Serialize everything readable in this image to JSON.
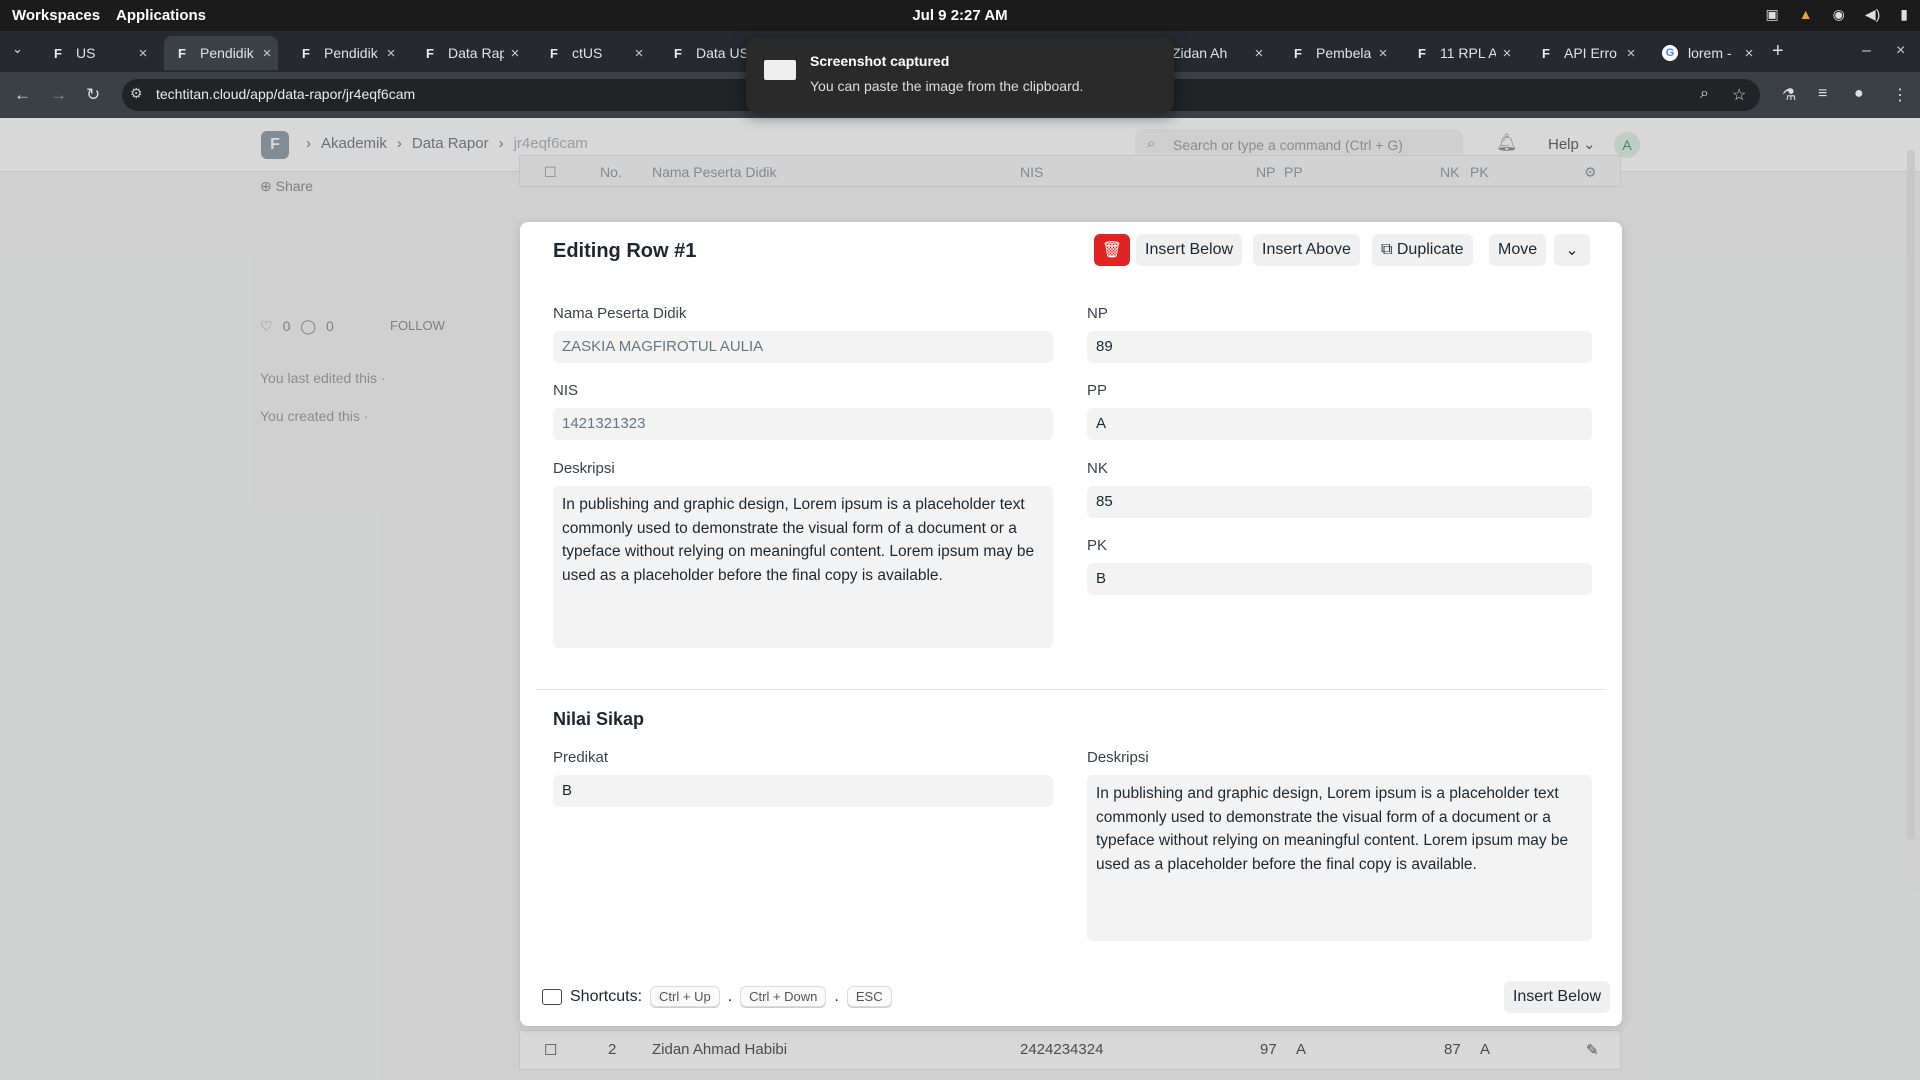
{
  "system": {
    "workspaces": "Workspaces",
    "applications": "Applications",
    "clock": "Jul 9  2:27 AM"
  },
  "tabs": [
    {
      "title": "US"
    },
    {
      "title": "Pendidik"
    },
    {
      "title": "Pendidik"
    },
    {
      "title": "Data Rap"
    },
    {
      "title": "ctUS"
    },
    {
      "title": "Data US"
    },
    {
      "title": "Zidan Ah"
    },
    {
      "title": "Pembela"
    },
    {
      "title": "11 RPL A"
    },
    {
      "title": "API Erro"
    },
    {
      "title": "lorem - "
    }
  ],
  "browser": {
    "url": "techtitan.cloud/app/data-rapor/jr4eqf6cam"
  },
  "toast": {
    "title": "Screenshot captured",
    "message": "You can paste the image from the clipboard."
  },
  "navbar": {
    "breadcrumbs": [
      "Akademik",
      "Data Rapor",
      "jr4eqf6cam"
    ],
    "search_placeholder": "Search or type a command (Ctrl + G)",
    "help": "Help",
    "avatar": "A"
  },
  "sidebar": {
    "share": "Share",
    "likes": "0",
    "comments": "0",
    "follow": "FOLLOW",
    "last_edited": "You last edited this ·",
    "created": "You created this ·"
  },
  "grid": {
    "headers": [
      "No.",
      "Nama Peserta Didik",
      "NIS",
      "NP",
      "PP",
      "NK",
      "PK"
    ],
    "row2": {
      "no": "2",
      "name": "Zidan Ahmad Habibi",
      "nis": "2424234324",
      "np": "97",
      "pp": "A",
      "nk": "87",
      "pk": "A"
    }
  },
  "editor": {
    "title": "Editing Row #1",
    "buttons": {
      "insert_below": "Insert Below",
      "insert_above": "Insert Above",
      "duplicate": "Duplicate",
      "move": "Move"
    },
    "fields": {
      "nama_label": "Nama Peserta Didik",
      "nama_value": "ZASKIA MAGFIROTUL AULIA",
      "nis_label": "NIS",
      "nis_value": "1421321323",
      "deskripsi_label": "Deskripsi",
      "deskripsi_value": "In publishing and graphic design, Lorem ipsum is a placeholder text commonly used to demonstrate the visual form of a document or a typeface without relying on meaningful content. Lorem ipsum may be used as a placeholder before the final copy is available.",
      "np_label": "NP",
      "np_value": "89",
      "pp_label": "PP",
      "pp_value": "A",
      "nk_label": "NK",
      "nk_value": "85",
      "pk_label": "PK",
      "pk_value": "B"
    },
    "sikap": {
      "section_title": "Nilai Sikap",
      "predikat_label": "Predikat",
      "predikat_value": "B",
      "deskripsi_label": "Deskripsi",
      "deskripsi_value": "In publishing and graphic design, Lorem ipsum is a placeholder text commonly used to demonstrate the visual form of a document or a typeface without relying on meaningful content. Lorem ipsum may be used as a placeholder before the final copy is available."
    },
    "shortcuts": {
      "label": "Shortcuts:",
      "keys": [
        "Ctrl + Up",
        "Ctrl + Down",
        "ESC"
      ],
      "dot": "."
    },
    "footer_insert_below": "Insert Below"
  }
}
